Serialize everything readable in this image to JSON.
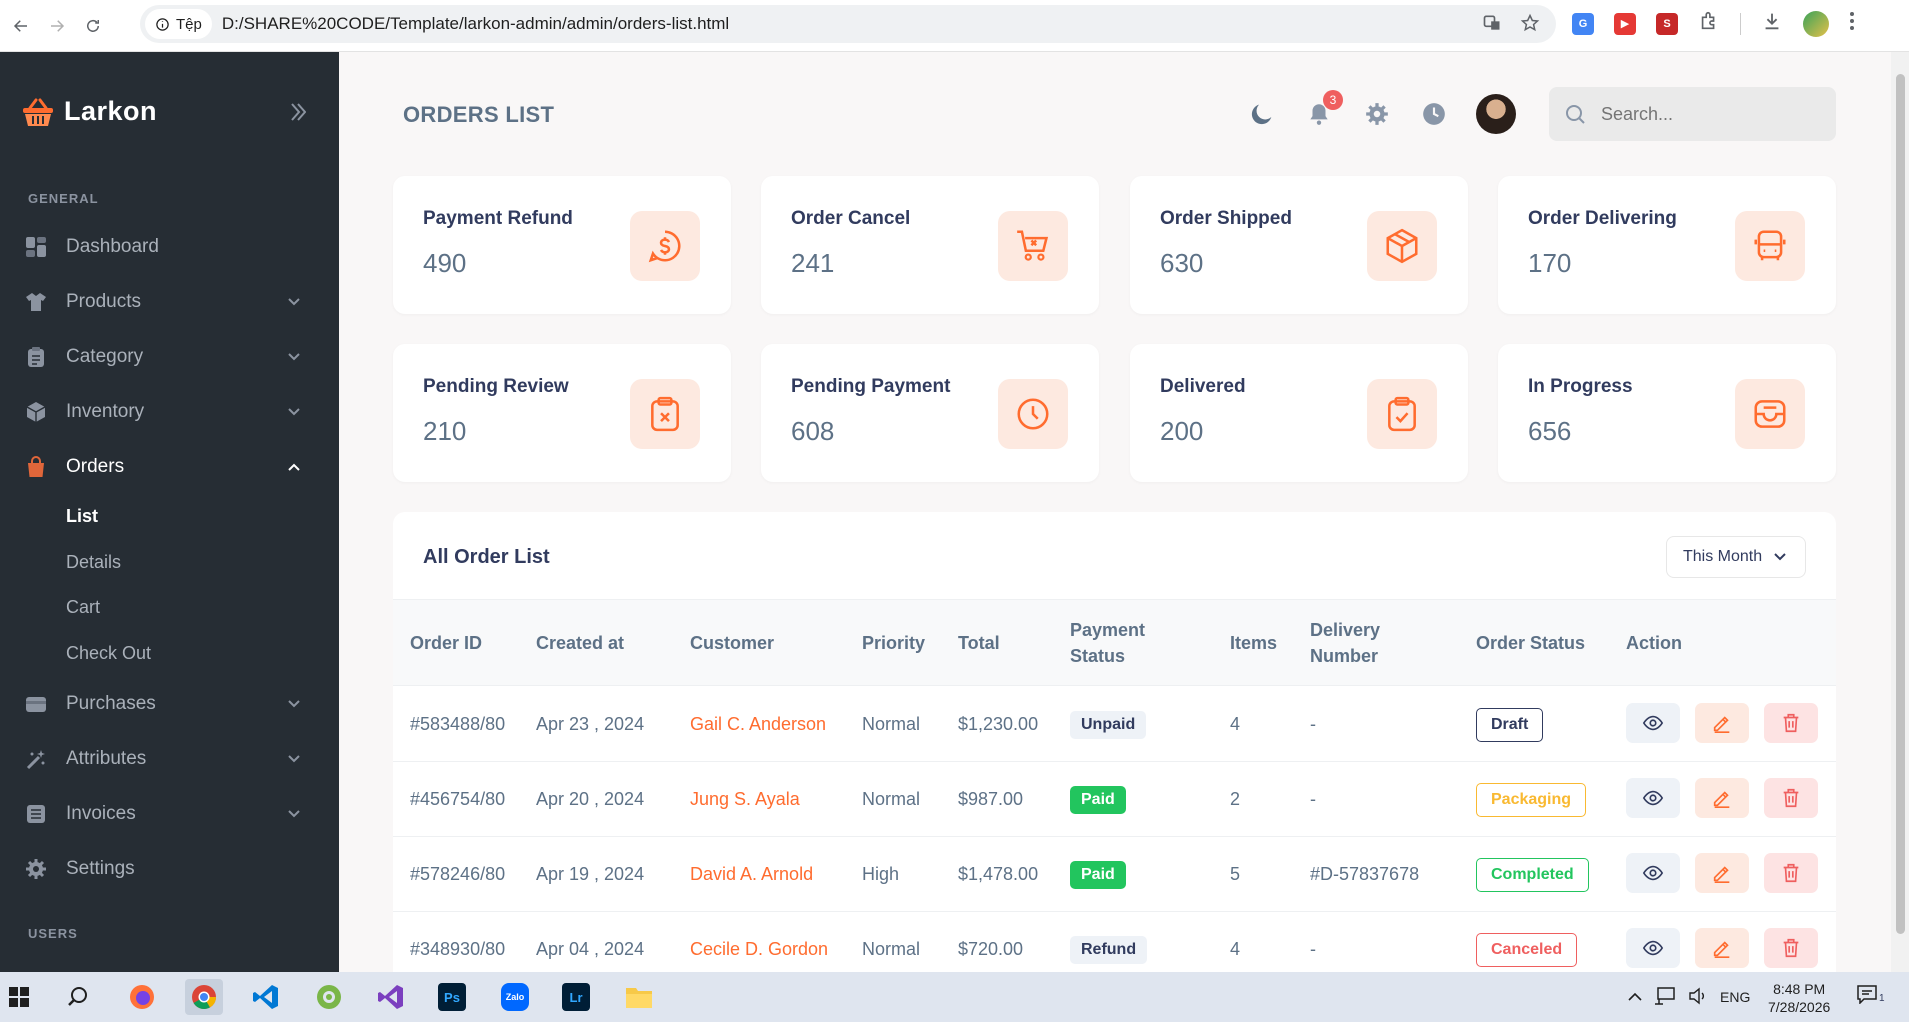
{
  "browser": {
    "site_chip": "Tệp",
    "url": "D:/SHARE%20CODE/Template/larkon-admin/admin/orders-list.html"
  },
  "sidebar": {
    "brand": "Larkon",
    "section_general": "GENERAL",
    "section_users": "USERS",
    "items": [
      {
        "label": "Dashboard",
        "icon": "dashboard-icon"
      },
      {
        "label": "Products",
        "icon": "tshirt-icon"
      },
      {
        "label": "Category",
        "icon": "clipboard-list-icon"
      },
      {
        "label": "Inventory",
        "icon": "box-icon"
      },
      {
        "label": "Orders",
        "icon": "bag-icon"
      },
      {
        "label": "Purchases",
        "icon": "card-icon"
      },
      {
        "label": "Attributes",
        "icon": "sparkle-icon"
      },
      {
        "label": "Invoices",
        "icon": "list-icon"
      },
      {
        "label": "Settings",
        "icon": "gear-icon"
      }
    ],
    "orders_sub": [
      "List",
      "Details",
      "Cart",
      "Check Out"
    ]
  },
  "topbar": {
    "title": "ORDERS LIST",
    "notifications": "3",
    "search_placeholder": "Search..."
  },
  "stats": [
    {
      "label": "Payment Refund",
      "value": "490",
      "icon": "dollar-chat-icon"
    },
    {
      "label": "Order Cancel",
      "value": "241",
      "icon": "cart-cancel-icon"
    },
    {
      "label": "Order Shipped",
      "value": "630",
      "icon": "package-icon"
    },
    {
      "label": "Order Delivering",
      "value": "170",
      "icon": "bus-icon"
    },
    {
      "label": "Pending Review",
      "value": "210",
      "icon": "clipboard-x-icon"
    },
    {
      "label": "Pending Payment",
      "value": "608",
      "icon": "clock-icon"
    },
    {
      "label": "Delivered",
      "value": "200",
      "icon": "clipboard-check-icon"
    },
    {
      "label": "In Progress",
      "value": "656",
      "icon": "inbox-icon"
    }
  ],
  "orders": {
    "title": "All Order List",
    "filter": "This Month",
    "headers": [
      "Order ID",
      "Created at",
      "Customer",
      "Priority",
      "Total",
      "Payment\nStatus",
      "Items",
      "Delivery\nNumber",
      "Order Status",
      "Action"
    ],
    "rows": [
      {
        "id": "#583488/80",
        "created": "Apr 23 , 2024",
        "customer": "Gail C. Anderson",
        "priority": "Normal",
        "total": "$1,230.00",
        "payment": "Unpaid",
        "items": "4",
        "delivery": "-",
        "status": "Draft"
      },
      {
        "id": "#456754/80",
        "created": "Apr 20 , 2024",
        "customer": "Jung S. Ayala",
        "priority": "Normal",
        "total": "$987.00",
        "payment": "Paid",
        "items": "2",
        "delivery": "-",
        "status": "Packaging"
      },
      {
        "id": "#578246/80",
        "created": "Apr 19 , 2024",
        "customer": "David A. Arnold",
        "priority": "High",
        "total": "$1,478.00",
        "payment": "Paid",
        "items": "5",
        "delivery": "#D-57837678",
        "status": "Completed"
      },
      {
        "id": "#348930/80",
        "created": "Apr 04 , 2024",
        "customer": "Cecile D. Gordon",
        "priority": "Normal",
        "total": "$720.00",
        "payment": "Refund",
        "items": "4",
        "delivery": "-",
        "status": "Canceled"
      }
    ]
  },
  "taskbar": {
    "language": "ENG",
    "time": "8:48 PM",
    "date": "7/28/2026",
    "notification_count": "1",
    "apps": [
      "start",
      "search",
      "firefox",
      "chrome",
      "vscode",
      "coccoc",
      "visual-studio",
      "photoshop",
      "zalo",
      "lightroom",
      "file-explorer"
    ]
  },
  "colors": {
    "accent": "#ff6c2f",
    "sidebar_bg": "#262d34",
    "paid": "#22c55e",
    "canceled": "#ef5f5f",
    "packaging": "#f9b931"
  }
}
